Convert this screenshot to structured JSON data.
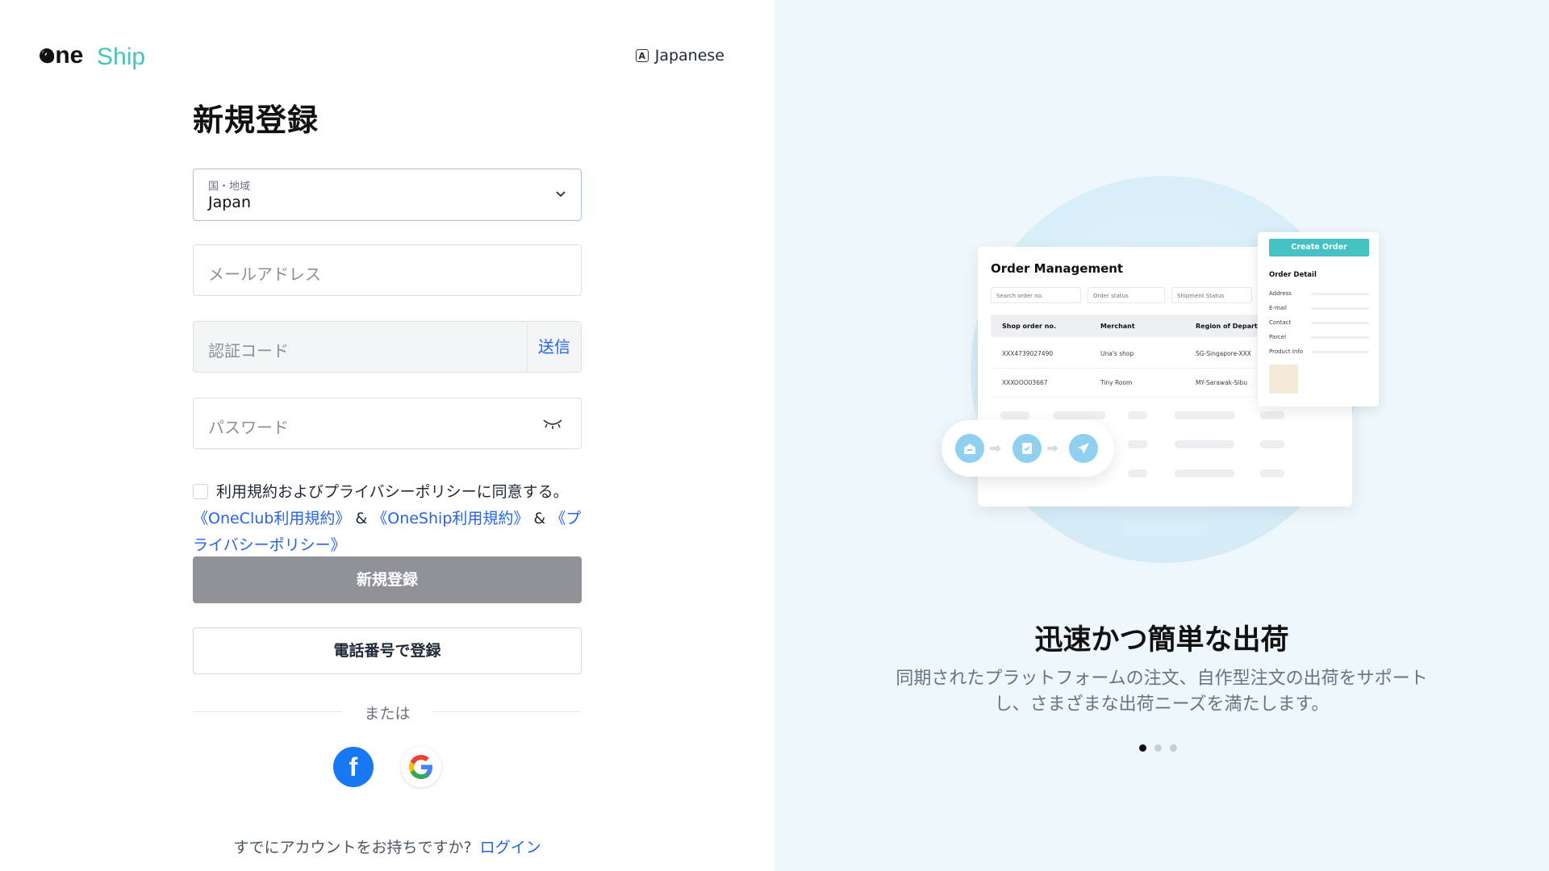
{
  "brand": {
    "logo_text_one": "one",
    "logo_text_ship": "Ship",
    "primary": "#2563eb",
    "teal": "#45c3c4"
  },
  "language": {
    "label": "Japanese",
    "icon": "translate-icon"
  },
  "form": {
    "title": "新規登録",
    "country": {
      "label": "国・地域",
      "value": "Japan"
    },
    "email": {
      "placeholder": "メールアドレス"
    },
    "code": {
      "placeholder": "認証コード",
      "send_label": "送信"
    },
    "password": {
      "placeholder": "パスワード"
    },
    "agree": {
      "text": "利用規約およびプライバシーポリシーに同意する。",
      "link1": "《OneClub利用規約》",
      "amp1": " & ",
      "link2": "《OneShip利用規約》",
      "amp2": " & ",
      "link3": "《プライバシーポリシー》"
    },
    "submit_label": "新規登録",
    "phone_label": "電話番号で登録",
    "or_label": "または",
    "social": [
      "facebook-icon",
      "google-icon"
    ],
    "login_prompt": "すでにアカウントをお持ちですか?",
    "login_link": "ログイン"
  },
  "illustration": {
    "card_title": "Order Management",
    "filters": [
      "Search order no.",
      "Order status",
      "Shipment Status"
    ],
    "table_headers": [
      "Shop order no.",
      "Merchant",
      "Region of Departure"
    ],
    "rows": [
      [
        "XXX4739027490",
        "Una's shop",
        "SG-Singapore-XXX"
      ],
      [
        "XXXOOO03667",
        "Tiny Room",
        "MY-Sarawak-Sibu"
      ]
    ],
    "detail": {
      "button": "Create Order",
      "heading": "Order Detail",
      "labels": [
        "Address",
        "E-mail",
        "Contact",
        "Parcel",
        "Product Info"
      ]
    }
  },
  "carousel": {
    "title": "迅速かつ簡単な出荷",
    "description": "同期されたプラットフォームの注文、自作型注文の出荷をサポートし、さまざまな出荷ニーズを満たします。",
    "slides": 3,
    "active_slide": 1
  }
}
